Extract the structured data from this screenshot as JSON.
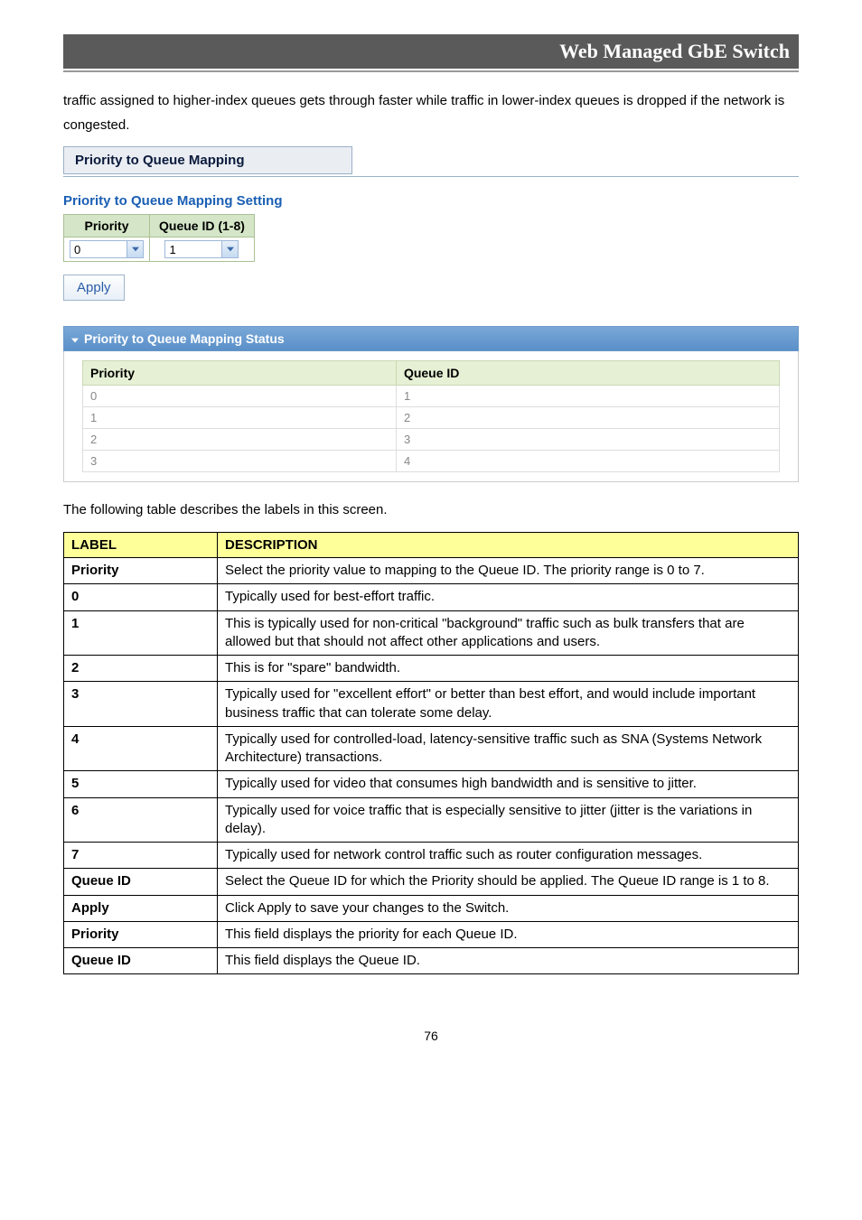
{
  "header": {
    "title": "Web Managed GbE Switch"
  },
  "intro": "traffic assigned to higher-index queues gets through faster while traffic in lower-index queues is dropped if the network is congested.",
  "panel_title": "Priority to Queue Mapping",
  "setting_section": {
    "heading": "Priority to Queue Mapping Setting",
    "cols": {
      "priority": "Priority",
      "queue": "Queue ID (1-8)"
    },
    "priority_value": "0",
    "queue_value": "1"
  },
  "apply_label": "Apply",
  "status_section": {
    "title": "Priority to Queue Mapping Status",
    "cols": {
      "priority": "Priority",
      "queue": "Queue ID"
    },
    "rows": [
      {
        "priority": "0",
        "queue": "1"
      },
      {
        "priority": "1",
        "queue": "2"
      },
      {
        "priority": "2",
        "queue": "3"
      },
      {
        "priority": "3",
        "queue": "4"
      }
    ]
  },
  "desc_intro": "The following table describes the labels in this screen.",
  "desc_table": {
    "headers": {
      "label": "LABEL",
      "description": "DESCRIPTION"
    },
    "rows": [
      {
        "label": "Priority",
        "description": "Select the priority value to mapping to the Queue ID. The priority range is 0 to 7."
      },
      {
        "label": "0",
        "description": "Typically used for best-effort traffic."
      },
      {
        "label": "1",
        "description": "This is typically used for non-critical \"background\" traffic such as bulk transfers that are allowed but that should not affect other applications and users."
      },
      {
        "label": "2",
        "description": "This is for \"spare\" bandwidth."
      },
      {
        "label": "3",
        "description": "Typically used for \"excellent effort\" or better than best effort, and would include important business traffic that can tolerate some delay."
      },
      {
        "label": "4",
        "description": "Typically used for controlled-load, latency-sensitive traffic such as SNA (Systems Network Architecture) transactions."
      },
      {
        "label": "5",
        "description": "Typically used for video that consumes high bandwidth and is sensitive to jitter."
      },
      {
        "label": "6",
        "description": "Typically used for voice traffic that is especially sensitive to jitter (jitter is the variations in delay)."
      },
      {
        "label": "7",
        "description": "Typically used for network control traffic such as router configuration messages."
      },
      {
        "label": "Queue ID",
        "description": "Select the Queue ID for which the Priority should be applied. The Queue ID range is 1 to 8."
      },
      {
        "label": "Apply",
        "description": "Click Apply to save your changes to the Switch."
      },
      {
        "label": "Priority",
        "description": "This field displays the priority for each Queue ID."
      },
      {
        "label": "Queue ID",
        "description": "This field displays the Queue ID."
      }
    ]
  },
  "page_number": "76"
}
